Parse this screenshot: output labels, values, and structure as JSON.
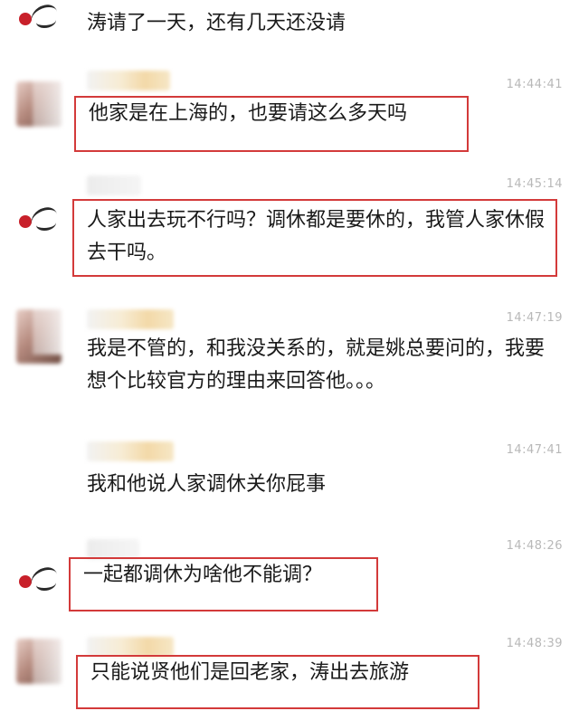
{
  "messages": [
    {
      "time": "",
      "text": "涛请了一天，还有几天还没请",
      "highlighted": false
    },
    {
      "time": "14:44:41",
      "text": "他家是在上海的，也要请这么多天吗",
      "highlighted": true
    },
    {
      "time": "14:45:14",
      "text": "人家出去玩不行吗？调休都是要休的，我管人家休假去干吗。",
      "highlighted": true
    },
    {
      "time": "14:47:19",
      "text": "我是不管的，和我没关系的，就是姚总要问的，我要想个比较官方的理由来回答他。。。",
      "highlighted": false
    },
    {
      "time": "14:47:41",
      "text": "我和他说人家调休关你屁事",
      "highlighted": false
    },
    {
      "time": "14:48:26",
      "text": "一起都调休为啥他不能调？",
      "highlighted": true
    },
    {
      "time": "14:48:39",
      "text": "只能说贤他们是回老家，涛出去旅游",
      "highlighted": true
    }
  ],
  "colors": {
    "highlight_border": "#d33a3a",
    "timestamp": "#b8b8b8",
    "text": "#1a1a1a"
  }
}
